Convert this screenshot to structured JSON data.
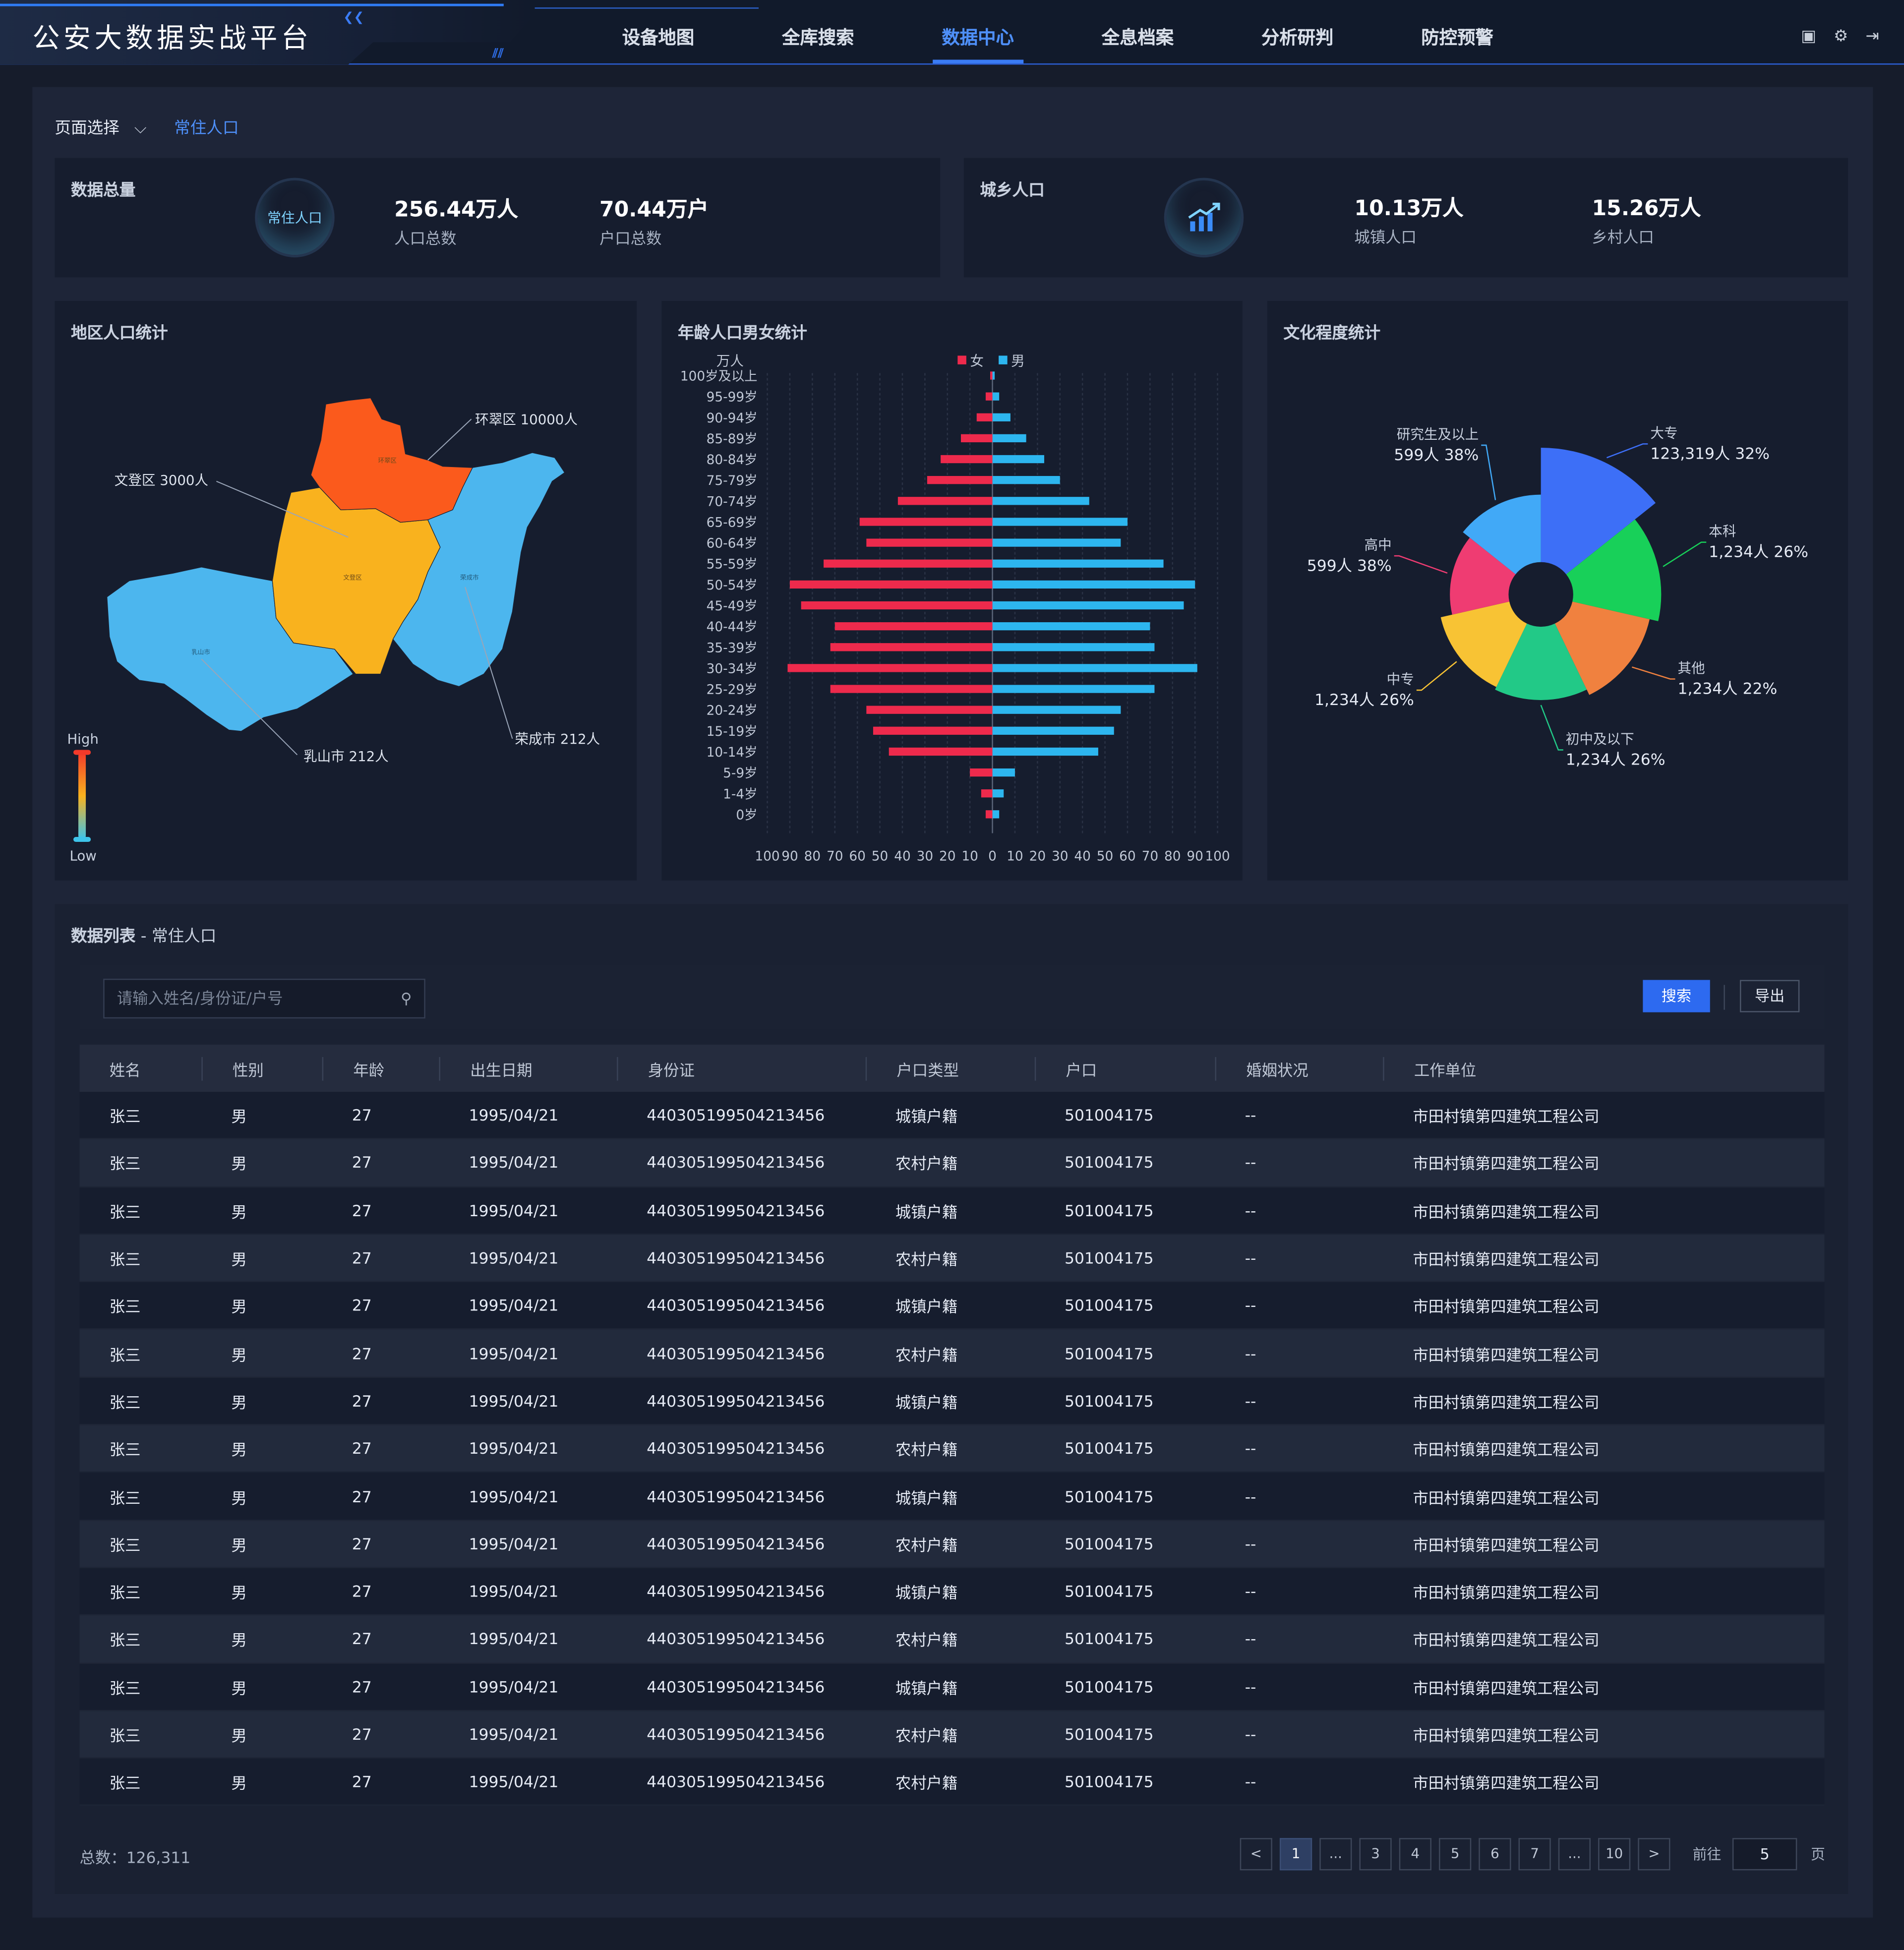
{
  "app": {
    "title": "公安大数据实战平台"
  },
  "nav": [
    {
      "label": "设备地图"
    },
    {
      "label": "全库搜索"
    },
    {
      "label": "数据中心"
    },
    {
      "label": "全息档案"
    },
    {
      "label": "分析研判"
    },
    {
      "label": "防控预警"
    }
  ],
  "nav_active": "数据中心",
  "header_icons": [
    "clipboard-icon",
    "gear-icon",
    "logout-icon"
  ],
  "page_select": {
    "label": "页面选择",
    "current": "常住人口"
  },
  "total_card": {
    "title": "数据总量",
    "badge": "常住人口",
    "population": {
      "value": "256.44万人",
      "label": "人口总数"
    },
    "households": {
      "value": "70.44万户",
      "label": "户口总数"
    }
  },
  "urban_card": {
    "title": "城乡人口",
    "icon": "bar-chart-growth-icon",
    "urban": {
      "value": "10.13万人",
      "label": "城镇人口"
    },
    "rural": {
      "value": "15.26万人",
      "label": "乡村人口"
    }
  },
  "map_panel": {
    "title": "地区人口统计",
    "labels": {
      "huancui": "环翠区 10000人",
      "wendeng": "文登区 3000人",
      "rushan": "乳山市 212人",
      "rongcheng": "荣成市 212人"
    },
    "small_labels": {
      "huancui": "环翠区",
      "wendeng": "文登区",
      "rushan": "乳山市",
      "rongcheng": "荣成市"
    },
    "legend": {
      "high": "High",
      "low": "Low"
    },
    "colors": {
      "huancui": "#fb5a1c",
      "wendeng": "#f9b21e",
      "rushan": "#4cb6ee",
      "rongcheng": "#4cb6ee"
    }
  },
  "chart_data": [
    {
      "type": "bar",
      "title": "年龄人口男女统计",
      "unit": "万人",
      "categories": [
        "100岁及以上",
        "95-99岁",
        "90-94岁",
        "85-89岁",
        "80-84岁",
        "75-79岁",
        "70-74岁",
        "65-69岁",
        "60-64岁",
        "55-59岁",
        "50-54岁",
        "45-49岁",
        "40-44岁",
        "35-39岁",
        "30-34岁",
        "25-29岁",
        "20-24岁",
        "15-19岁",
        "10-14岁",
        "5-9岁",
        "1-4岁",
        "0岁"
      ],
      "series": [
        {
          "name": "女",
          "color": "#ee2a4c",
          "values": [
            1,
            3,
            7,
            14,
            23,
            29,
            42,
            59,
            56,
            75,
            90,
            85,
            70,
            72,
            91,
            72,
            56,
            53,
            46,
            10,
            5,
            3
          ]
        },
        {
          "name": "男",
          "color": "#2db6ef",
          "values": [
            1,
            3,
            8,
            15,
            23,
            30,
            43,
            60,
            57,
            76,
            90,
            85,
            70,
            72,
            91,
            72,
            57,
            54,
            47,
            10,
            5,
            3
          ]
        }
      ],
      "xticks": [
        "100",
        "90",
        "80",
        "70",
        "60",
        "50",
        "40",
        "30",
        "20",
        "10",
        "0",
        "10",
        "20",
        "30",
        "40",
        "50",
        "60",
        "70",
        "80",
        "90",
        "100"
      ],
      "xlim": [
        -100,
        100
      ],
      "grid": true,
      "legend": "top"
    },
    {
      "type": "pie",
      "title": "文化程度统计",
      "rose": true,
      "slices": [
        {
          "name": "大专",
          "value_label": "123,319人",
          "pct": "32%",
          "color": "#3d6ff7",
          "r": 1.0
        },
        {
          "name": "本科",
          "value_label": "1,234人",
          "pct": "26%",
          "color": "#18d059",
          "r": 0.82
        },
        {
          "name": "其他",
          "value_label": "1,234人",
          "pct": "22%",
          "color": "#f0813f",
          "r": 0.76
        },
        {
          "name": "初中及以下",
          "value_label": "1,234人",
          "pct": "26%",
          "color": "#22c987",
          "r": 0.72
        },
        {
          "name": "中专",
          "value_label": "1,234人",
          "pct": "26%",
          "color": "#f8c334",
          "r": 0.7
        },
        {
          "name": "高中",
          "value_label": "599人",
          "pct": "38%",
          "color": "#ef3c72",
          "r": 0.62
        },
        {
          "name": "研究生及以上",
          "value_label": "599人",
          "pct": "38%",
          "color": "#41a9f7",
          "r": 0.68
        }
      ]
    }
  ],
  "list": {
    "title": "数据列表",
    "subtitle": "常住人口",
    "search_placeholder": "请输入姓名/身份证/户号",
    "search_label": "搜索",
    "export_label": "导出",
    "columns": [
      "姓名",
      "性别",
      "年龄",
      "出生日期",
      "身份证",
      "户口类型",
      "户口",
      "婚姻状况",
      "工作单位"
    ],
    "rows": [
      [
        "张三",
        "男",
        "27",
        "1995/04/21",
        "440305199504213456",
        "城镇户籍",
        "501004175",
        "--",
        "市田村镇第四建筑工程公司"
      ],
      [
        "张三",
        "男",
        "27",
        "1995/04/21",
        "440305199504213456",
        "农村户籍",
        "501004175",
        "--",
        "市田村镇第四建筑工程公司"
      ],
      [
        "张三",
        "男",
        "27",
        "1995/04/21",
        "440305199504213456",
        "城镇户籍",
        "501004175",
        "--",
        "市田村镇第四建筑工程公司"
      ],
      [
        "张三",
        "男",
        "27",
        "1995/04/21",
        "440305199504213456",
        "农村户籍",
        "501004175",
        "--",
        "市田村镇第四建筑工程公司"
      ],
      [
        "张三",
        "男",
        "27",
        "1995/04/21",
        "440305199504213456",
        "城镇户籍",
        "501004175",
        "--",
        "市田村镇第四建筑工程公司"
      ],
      [
        "张三",
        "男",
        "27",
        "1995/04/21",
        "440305199504213456",
        "农村户籍",
        "501004175",
        "--",
        "市田村镇第四建筑工程公司"
      ],
      [
        "张三",
        "男",
        "27",
        "1995/04/21",
        "440305199504213456",
        "城镇户籍",
        "501004175",
        "--",
        "市田村镇第四建筑工程公司"
      ],
      [
        "张三",
        "男",
        "27",
        "1995/04/21",
        "440305199504213456",
        "农村户籍",
        "501004175",
        "--",
        "市田村镇第四建筑工程公司"
      ],
      [
        "张三",
        "男",
        "27",
        "1995/04/21",
        "440305199504213456",
        "城镇户籍",
        "501004175",
        "--",
        "市田村镇第四建筑工程公司"
      ],
      [
        "张三",
        "男",
        "27",
        "1995/04/21",
        "440305199504213456",
        "农村户籍",
        "501004175",
        "--",
        "市田村镇第四建筑工程公司"
      ],
      [
        "张三",
        "男",
        "27",
        "1995/04/21",
        "440305199504213456",
        "城镇户籍",
        "501004175",
        "--",
        "市田村镇第四建筑工程公司"
      ],
      [
        "张三",
        "男",
        "27",
        "1995/04/21",
        "440305199504213456",
        "农村户籍",
        "501004175",
        "--",
        "市田村镇第四建筑工程公司"
      ],
      [
        "张三",
        "男",
        "27",
        "1995/04/21",
        "440305199504213456",
        "城镇户籍",
        "501004175",
        "--",
        "市田村镇第四建筑工程公司"
      ],
      [
        "张三",
        "男",
        "27",
        "1995/04/21",
        "440305199504213456",
        "农村户籍",
        "501004175",
        "--",
        "市田村镇第四建筑工程公司"
      ],
      [
        "张三",
        "男",
        "27",
        "1995/04/21",
        "440305199504213456",
        "农村户籍",
        "501004175",
        "--",
        "市田村镇第四建筑工程公司"
      ]
    ],
    "total": "总数：126,311"
  },
  "pagination": {
    "prev": "<",
    "next": ">",
    "pages": [
      "1",
      "...",
      "3",
      "4",
      "5",
      "6",
      "7",
      "...",
      "10"
    ],
    "current": "1",
    "goto_label": "前往",
    "goto_value": "5",
    "goto_unit": "页"
  }
}
